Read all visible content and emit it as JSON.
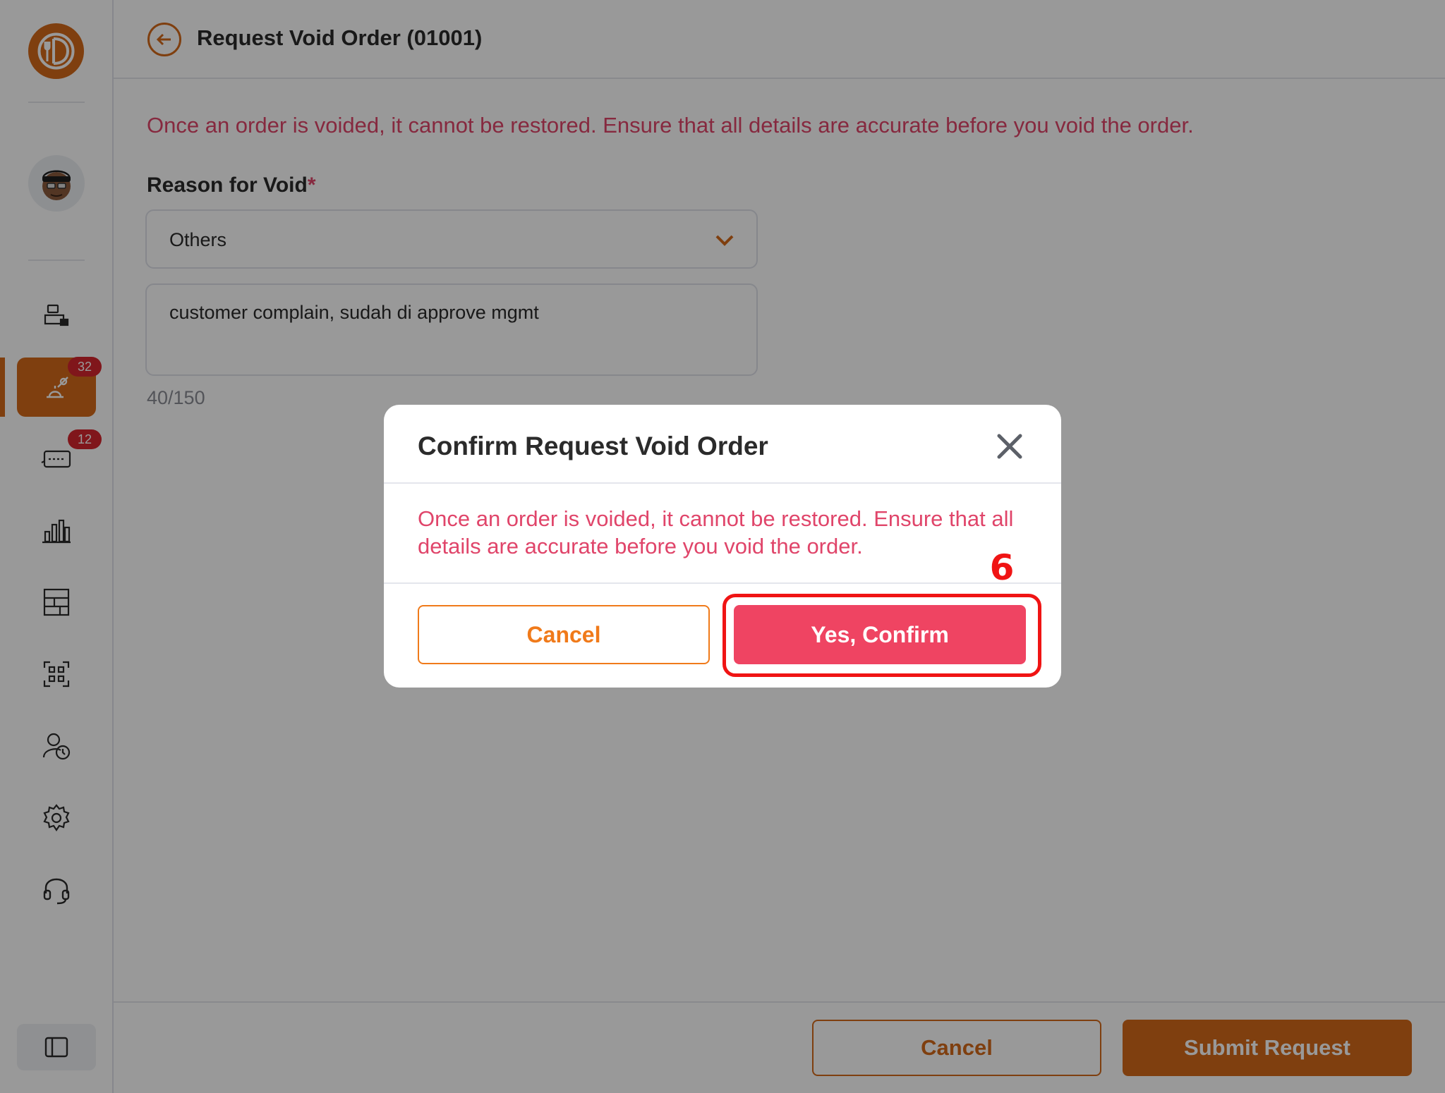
{
  "app": {
    "brand_color": "#d4691a",
    "danger_color": "#e0456a"
  },
  "sidebar": {
    "logo_icon": "restaurant-logo-icon",
    "avatar_icon": "user-avatar-icon",
    "items": [
      {
        "name": "cashier-icon"
      },
      {
        "name": "orders-icon",
        "badge": "32",
        "active": true
      },
      {
        "name": "online-orders-icon",
        "badge": "12"
      },
      {
        "name": "reports-icon"
      },
      {
        "name": "inventory-icon"
      },
      {
        "name": "qr-code-icon"
      },
      {
        "name": "attendance-icon"
      },
      {
        "name": "settings-icon"
      },
      {
        "name": "support-icon"
      }
    ],
    "toggle_icon": "sidebar-toggle-icon"
  },
  "header": {
    "title": "Request Void Order (01001)",
    "back_icon": "arrow-left-icon"
  },
  "form": {
    "warning": "Once an order is voided, it cannot be restored. Ensure that all details are accurate before you void the order.",
    "reason_label": "Reason for Void",
    "required_mark": "*",
    "reason_value": "Others",
    "notes_value": "customer complain, sudah di approve mgmt",
    "char_count": "40/150"
  },
  "footer": {
    "cancel_label": "Cancel",
    "submit_label": "Submit Request"
  },
  "modal": {
    "title": "Confirm Request Void Order",
    "message": "Once an order is voided, it cannot be restored. Ensure that all details are accurate before you void the order.",
    "cancel_label": "Cancel",
    "confirm_label": "Yes, Confirm",
    "close_icon": "close-icon"
  },
  "annotation": {
    "step_number": "6",
    "color": "#f01414"
  }
}
